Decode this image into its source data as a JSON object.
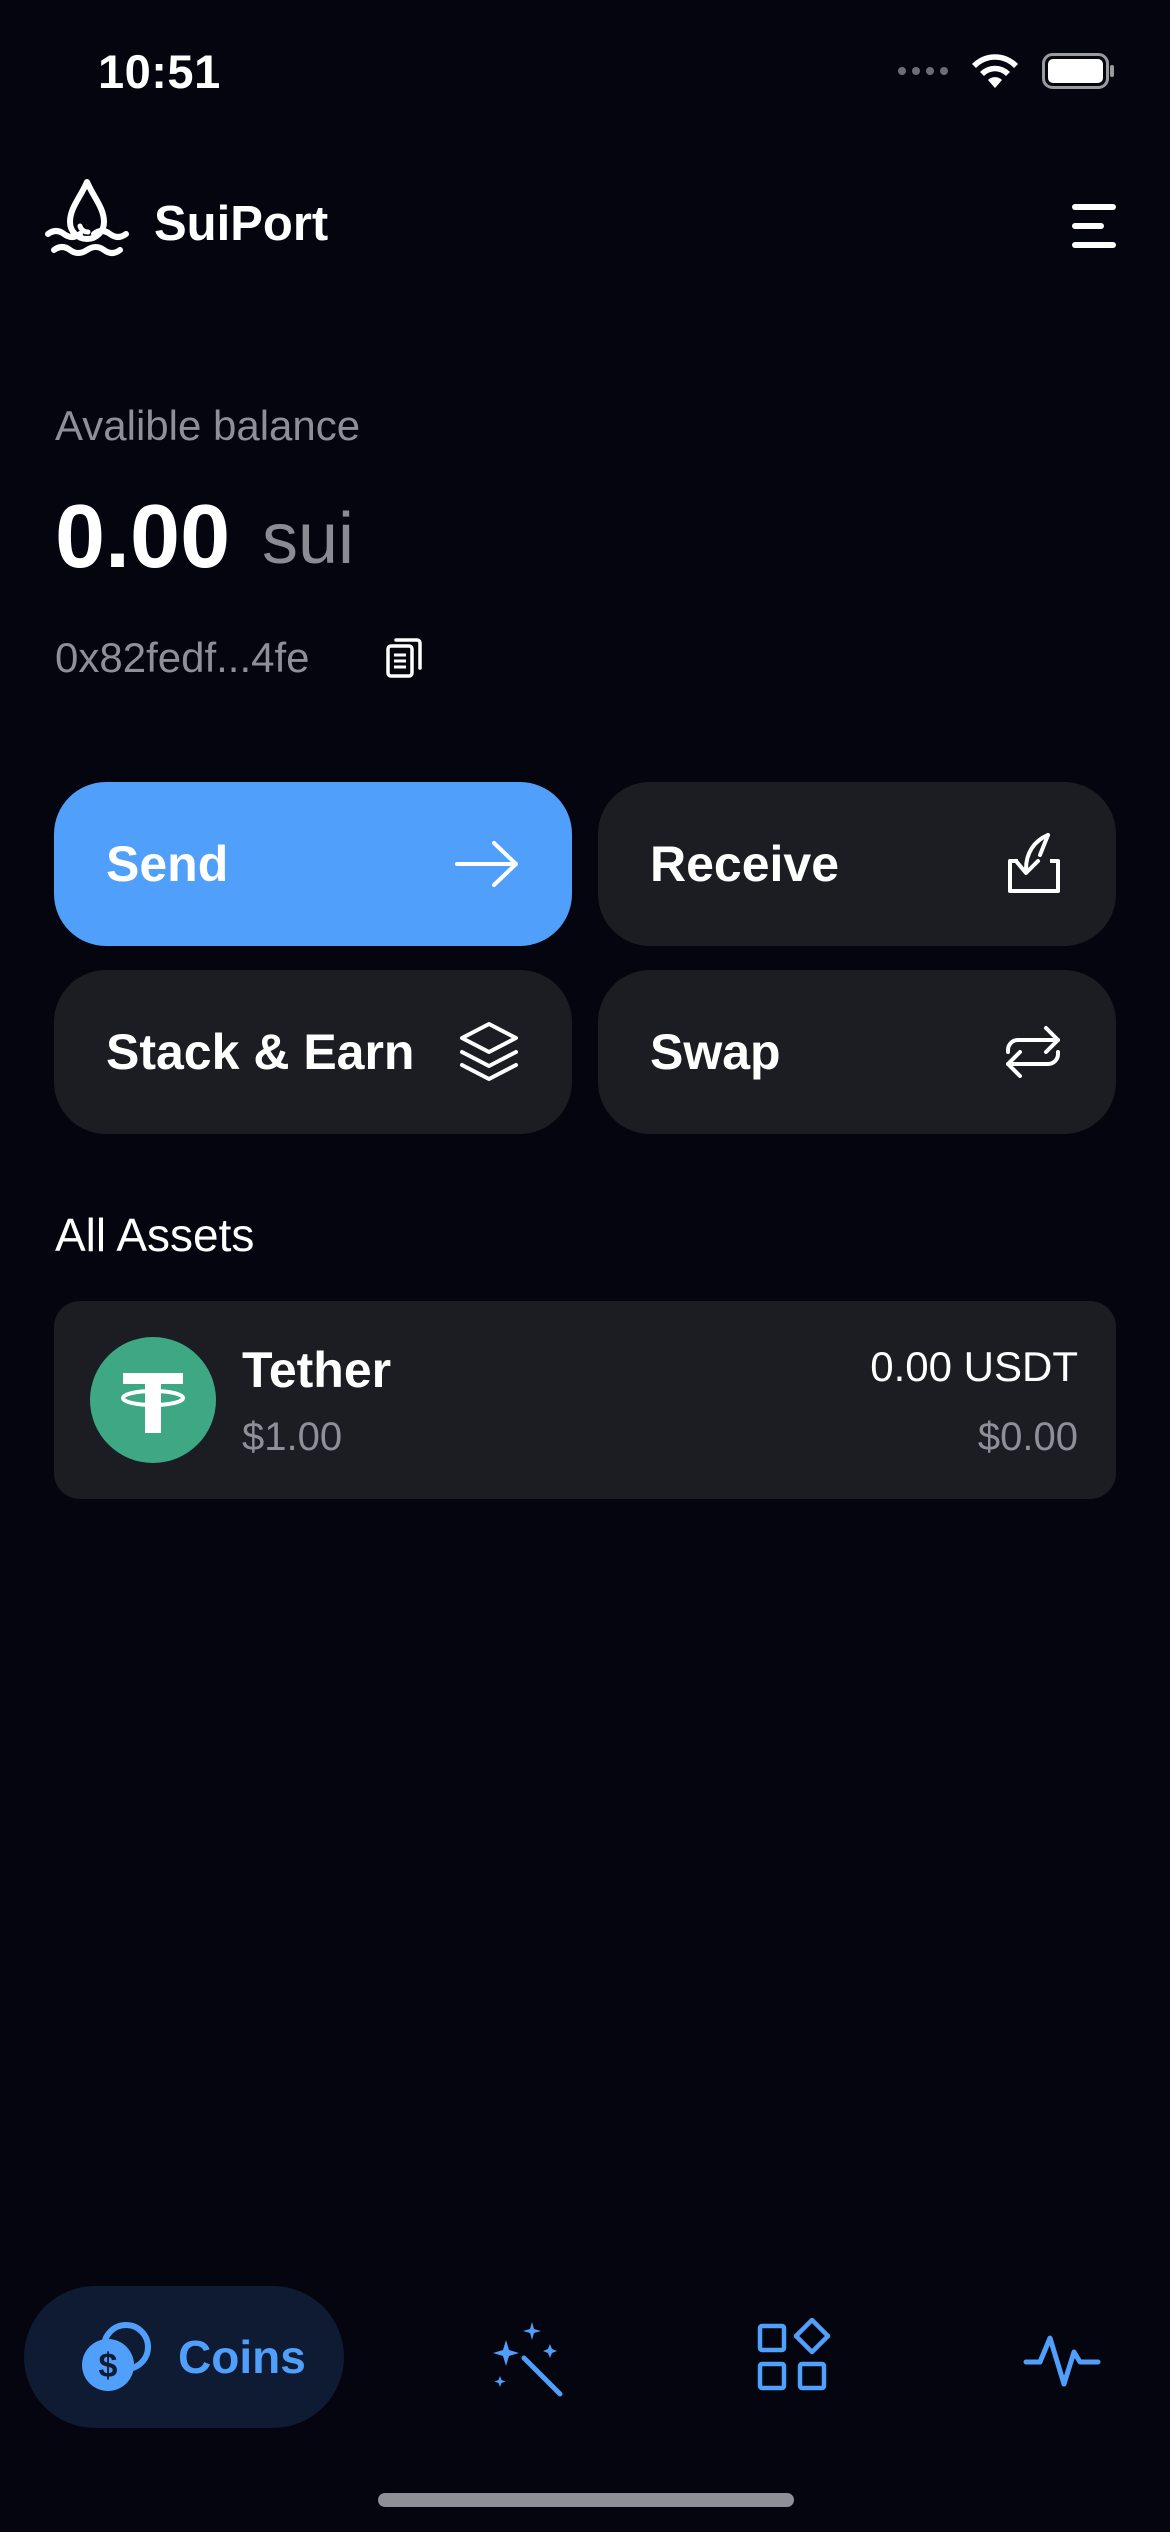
{
  "status_bar": {
    "time": "10:51"
  },
  "header": {
    "app_name": "SuiPort",
    "logo_icon": "water-drop-waves-icon",
    "menu_icon": "hamburger-menu-icon"
  },
  "balance": {
    "label": "Avalible balance",
    "amount": "0.00",
    "unit": "sui",
    "address": "0x82fedf...4fe",
    "copy_icon": "copy-icon"
  },
  "actions": {
    "send": {
      "label": "Send",
      "icon": "arrow-right-icon",
      "color": "#4f9ffb"
    },
    "receive": {
      "label": "Receive",
      "icon": "receive-download-icon"
    },
    "stack_earn": {
      "label": "Stack & Earn",
      "icon": "layers-icon"
    },
    "swap": {
      "label": "Swap",
      "icon": "swap-arrows-icon"
    }
  },
  "assets": {
    "title": "All Assets",
    "items": [
      {
        "name": "Tether",
        "price": "$1.00",
        "amount": "0.00 USDT",
        "value": "$0.00",
        "icon": "tether-icon",
        "color": "#3da883"
      }
    ]
  },
  "bottom_nav": {
    "coins": {
      "label": "Coins",
      "icon": "coins-dollar-icon",
      "active": true
    },
    "items": [
      {
        "icon": "magic-wand-sparkles-icon"
      },
      {
        "icon": "apps-grid-icon"
      },
      {
        "icon": "activity-pulse-icon"
      }
    ],
    "accent": "#4f9ffb"
  }
}
